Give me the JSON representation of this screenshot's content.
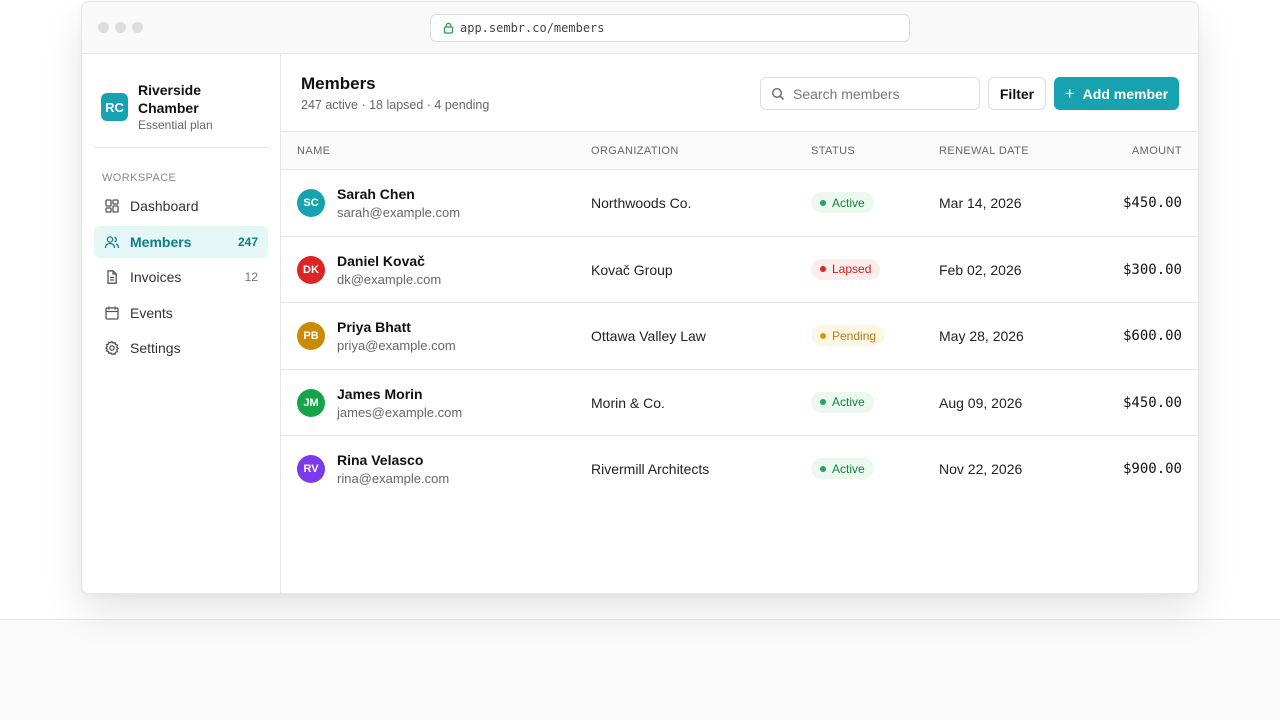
{
  "browser": {
    "url": "app.sembr.co/members"
  },
  "sidebar": {
    "org_initials": "RC",
    "org_name": "Riverside Chamber",
    "org_plan": "Essential plan",
    "section_label": "WORKSPACE",
    "items": [
      {
        "label": "Dashboard",
        "icon": "dashboard-icon",
        "count": ""
      },
      {
        "label": "Members",
        "icon": "users-icon",
        "count": "247",
        "active": true
      },
      {
        "label": "Invoices",
        "icon": "file-icon",
        "count": "12"
      },
      {
        "label": "Events",
        "icon": "calendar-icon",
        "count": ""
      },
      {
        "label": "Settings",
        "icon": "gear-icon",
        "count": ""
      }
    ]
  },
  "header": {
    "title": "Members",
    "subtitle": "247 active · 18 lapsed · 4 pending",
    "search_placeholder": "Search members",
    "filter_label": "Filter",
    "add_label": "Add member"
  },
  "table": {
    "columns": {
      "name": "NAME",
      "organization": "ORGANIZATION",
      "status": "STATUS",
      "renewal": "RENEWAL DATE",
      "amount": "AMOUNT"
    },
    "rows": [
      {
        "initials": "SC",
        "avatar_color": "#17a2b0",
        "name": "Sarah Chen",
        "email": "sarah@example.com",
        "organization": "Northwoods Co.",
        "status": "Active",
        "renewal": "Mar 14, 2026",
        "amount": "$450.00"
      },
      {
        "initials": "DK",
        "avatar_color": "#dc2626",
        "name": "Daniel Kovač",
        "email": "dk@example.com",
        "organization": "Kovač Group",
        "status": "Lapsed",
        "renewal": "Feb 02, 2026",
        "amount": "$300.00"
      },
      {
        "initials": "PB",
        "avatar_color": "#ca8a04",
        "name": "Priya Bhatt",
        "email": "priya@example.com",
        "organization": "Ottawa Valley Law",
        "status": "Pending",
        "renewal": "May 28, 2026",
        "amount": "$600.00"
      },
      {
        "initials": "JM",
        "avatar_color": "#16a34a",
        "name": "James Morin",
        "email": "james@example.com",
        "organization": "Morin & Co.",
        "status": "Active",
        "renewal": "Aug 09, 2026",
        "amount": "$450.00"
      },
      {
        "initials": "RV",
        "avatar_color": "#7c3aed",
        "name": "Rina Velasco",
        "email": "rina@example.com",
        "organization": "Rivermill Architects",
        "status": "Active",
        "renewal": "Nov 22, 2026",
        "amount": "$900.00"
      }
    ]
  },
  "status_colors": {
    "Active": {
      "bg": "#eaf8ef",
      "fg": "#15803d",
      "dot": "#22a559"
    },
    "Lapsed": {
      "bg": "#fdecec",
      "fg": "#c81e1e",
      "dot": "#dc2626"
    },
    "Pending": {
      "bg": "#fdf6e3",
      "fg": "#b7791f",
      "dot": "#d19a12"
    }
  },
  "colors": {
    "accent": "#17a2b0"
  }
}
